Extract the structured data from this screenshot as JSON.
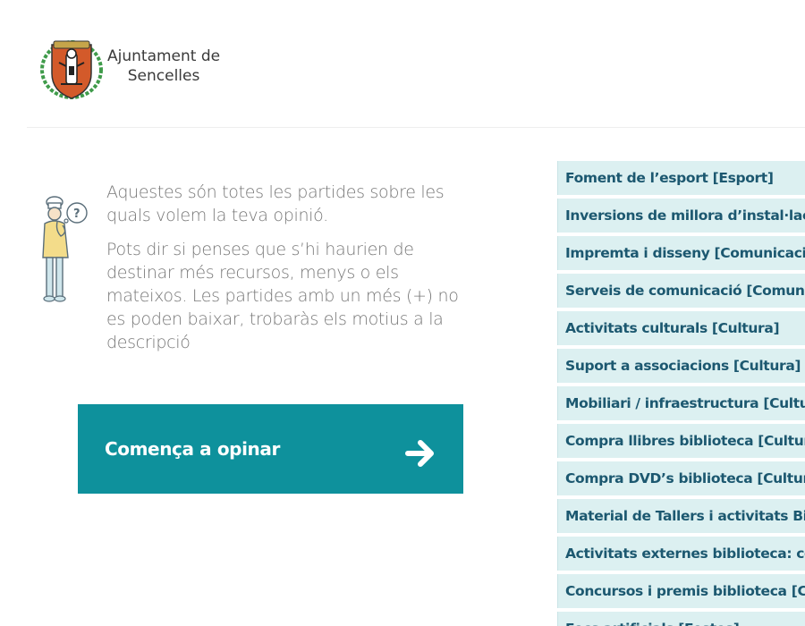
{
  "header": {
    "logo_icon": "municipal-crest-icon",
    "logo_line1": "Ajuntament de",
    "logo_line2": "Sencelles"
  },
  "intro": {
    "mascot_icon": "chef-thinking-icon",
    "paragraph1": "Aquestes són totes les partides sobre les quals volem la teva opinió.",
    "paragraph2": "Pots dir si penses que s’hi haurien de destinar més recursos, menys o els mateixos. Les partides amb un més (+) no es poden baixar, trobaràs els motius a la descripció"
  },
  "cta": {
    "label": "Comença a opinar",
    "icon": "arrow-right-icon",
    "color": "#0e919c"
  },
  "budget_items": [
    "Foment de l’esport [Esport]",
    "Inversions de millora d’instal·lacions p",
    "Impremta i disseny [Comunicació]",
    "Serveis de comunicació [Comunicació",
    "Activitats culturals [Cultura]",
    "Suport a associacions [Cultura]",
    "Mobiliari / infraestructura [Cultura]",
    "Compra llibres biblioteca [Cultura]",
    "Compra DVD’s biblioteca [Cultura]",
    "Material de Tallers i activitats Bibliote",
    "Activitats externes biblioteca: contac",
    "Concursos i premis biblioteca [Cultura",
    "Focs artificials [Festes]"
  ],
  "colors": {
    "accent": "#0e919c",
    "list_bg": "#dcf0f1",
    "list_text": "#1c5870"
  }
}
